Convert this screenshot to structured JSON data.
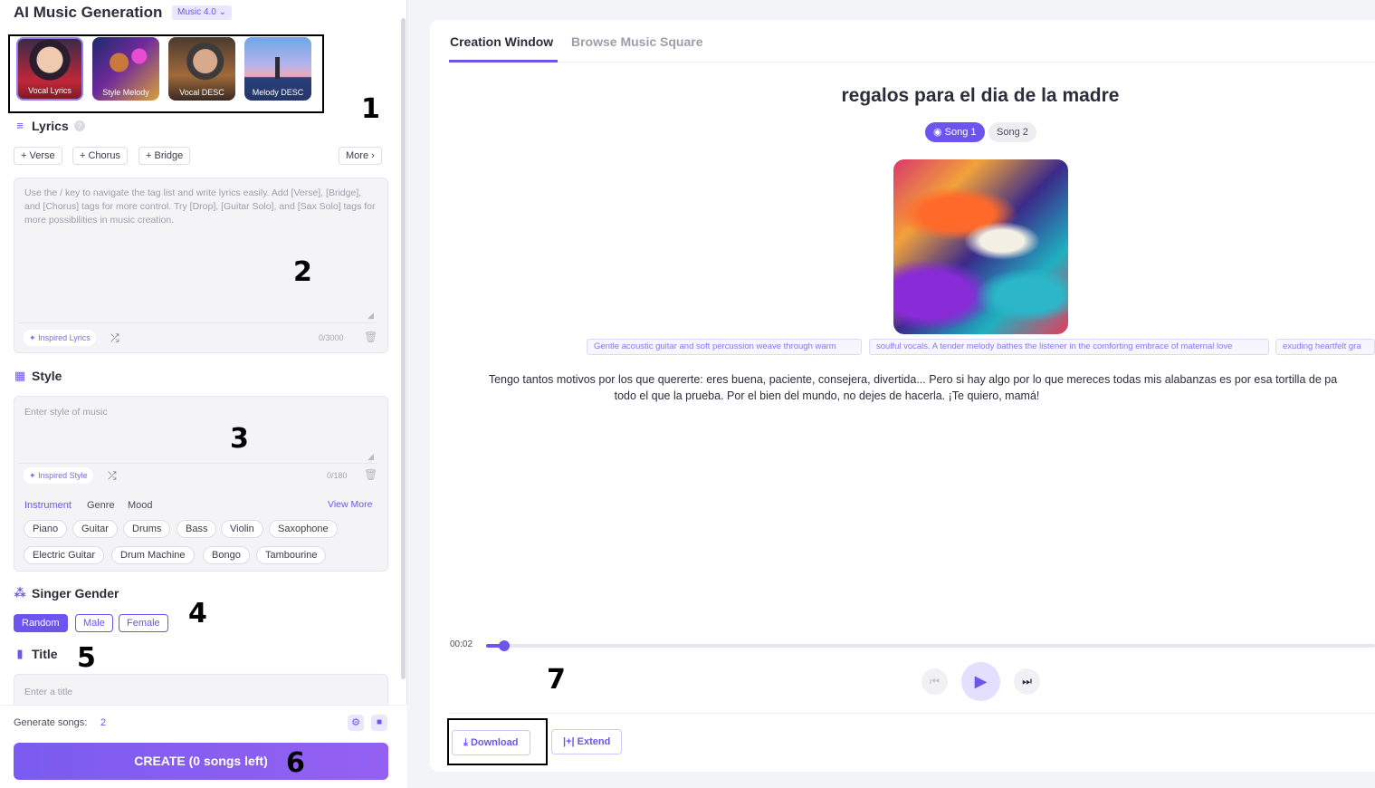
{
  "app": {
    "title": "AI Music Generation",
    "model": "Music 4.0"
  },
  "modes": [
    {
      "label": "Vocal Lyrics"
    },
    {
      "label": "Style Melody"
    },
    {
      "label": "Vocal DESC"
    },
    {
      "label": "Melody DESC"
    }
  ],
  "annotations": [
    "1",
    "2",
    "3",
    "4",
    "5",
    "6",
    "7"
  ],
  "lyrics": {
    "heading": "Lyrics",
    "tags": [
      "+ Verse",
      "+ Chorus",
      "+ Bridge"
    ],
    "more": "More",
    "placeholder": "Use the / key to navigate the tag list and write lyrics easily. Add [Verse], [Bridge], and [Chorus] tags for more control. Try [Drop], [Guitar Solo], and [Sax Solo] tags for more possibilities in music creation.",
    "inspired": "Inspired Lyrics",
    "counter": "0/3000"
  },
  "style": {
    "heading": "Style",
    "placeholder": "Enter style of music",
    "inspired": "Inspired Style",
    "counter": "0/180",
    "tabs": [
      "Instrument",
      "Genre",
      "Mood"
    ],
    "view_more": "View More",
    "instruments_row1": [
      "Piano",
      "Guitar",
      "Drums",
      "Bass",
      "Violin",
      "Saxophone"
    ],
    "instruments_row2": [
      "Electric Guitar",
      "Drum Machine",
      "Bongo",
      "Tambourine"
    ]
  },
  "singer": {
    "heading": "Singer Gender",
    "options": [
      "Random",
      "Male",
      "Female"
    ],
    "selected": "Random"
  },
  "title_section": {
    "heading": "Title",
    "placeholder": "Enter a title"
  },
  "generate": {
    "label": "Generate songs:",
    "count": "2"
  },
  "create_button": "CREATE (0 songs left)",
  "tabs": {
    "active": "Creation Window",
    "other": "Browse Music Square"
  },
  "song": {
    "title": "regalos para el dia de la madre",
    "versions": [
      "Song 1",
      "Song 2"
    ],
    "tags": [
      "Gentle acoustic guitar and soft percussion weave through warm",
      "soulful vocals. A tender melody bathes the listener in the comforting embrace of maternal love",
      "exuding heartfelt gra"
    ],
    "lyrics_line1": "Tengo tantos motivos por los que quererte: eres buena, paciente, consejera, divertida... Pero si hay algo por lo que mereces todas mis alabanzas es por esa tortilla de pa",
    "lyrics_line2": "todo el que la prueba. Por el bien del mundo, no dejes de hacerla. ¡Te quiero, mamá!"
  },
  "player": {
    "current_time": "00:02",
    "progress_pct": 2
  },
  "actions": {
    "download": "Download",
    "extend": "Extend"
  },
  "colors": {
    "accent": "#6b55ee",
    "tag_text": "#8676ef"
  }
}
